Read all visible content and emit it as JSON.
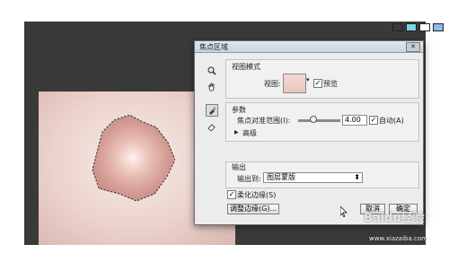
{
  "dialog": {
    "title": "焦点区域",
    "close_label": "✕",
    "view_mode": {
      "section_label": "视图模式",
      "view_label": "视图:",
      "preview_label": "预览",
      "preview_checked": true
    },
    "params": {
      "section_label": "参数",
      "focus_range_label": "焦点对准范围(I):",
      "focus_value": "4.00",
      "focus_level": 0.35,
      "auto_label": "自动(A)",
      "auto_checked": true,
      "advanced_label": "高级"
    },
    "output": {
      "section_label": "输出",
      "output_to_label": "输出到:",
      "output_to_value": "图层蒙版"
    },
    "soften_label": "柔化边缘(S)",
    "soften_checked": true,
    "refine_edge_button": "调整边缘(G)...",
    "cancel_button": "取消",
    "ok_button": "确定"
  },
  "watermark": {
    "logo_text": "Baidu经验",
    "url_text": "www.xiazaiba.com"
  },
  "colors": {
    "app_background": "#3a3a3a",
    "canvas_light": "#f7ebe7",
    "canvas_dark": "#d9b7b0"
  },
  "icons": {
    "zoom": "magnifier-icon",
    "hand": "hand-icon",
    "brush": "brush-icon",
    "eraser": "eraser-icon",
    "triangle": "triangle-right-icon",
    "cursor": "mouse-cursor-icon"
  }
}
